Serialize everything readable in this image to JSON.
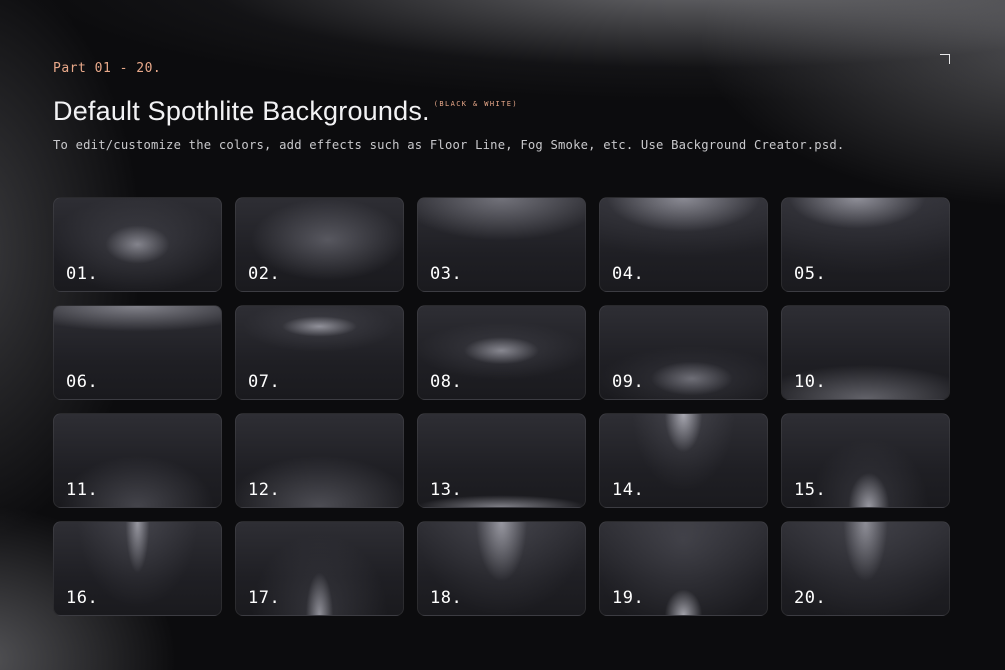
{
  "header": {
    "part": "Part 01 - 20.",
    "title": "Default Spothlite Backgrounds.",
    "tag": "(BLACK & WHITE)",
    "subtitle": "To edit/customize the colors, add effects such as Floor Line, Fog Smoke, etc. Use Background Creator.psd."
  },
  "tiles": [
    {
      "label": "01."
    },
    {
      "label": "02."
    },
    {
      "label": "03."
    },
    {
      "label": "04."
    },
    {
      "label": "05."
    },
    {
      "label": "06."
    },
    {
      "label": "07."
    },
    {
      "label": "08."
    },
    {
      "label": "09."
    },
    {
      "label": "10."
    },
    {
      "label": "11."
    },
    {
      "label": "12."
    },
    {
      "label": "13."
    },
    {
      "label": "14."
    },
    {
      "label": "15."
    },
    {
      "label": "16."
    },
    {
      "label": "17."
    },
    {
      "label": "18."
    },
    {
      "label": "19."
    },
    {
      "label": "20."
    }
  ],
  "colors": {
    "accent": "#e9a98a",
    "background": "#0c0c0e",
    "tile": "#26262b"
  },
  "icons": {
    "corner": "corner-bracket-icon"
  }
}
